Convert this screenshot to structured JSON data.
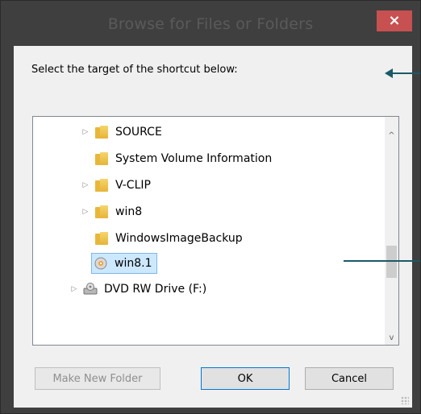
{
  "window": {
    "title": "Browse for Files or Folders",
    "close_glyph": "×"
  },
  "prompt": "Select the target of the shortcut below:",
  "tree": {
    "items": [
      {
        "label": "SOURCE",
        "expander": "▷",
        "icon": "folder-icon"
      },
      {
        "label": "System Volume Information",
        "expander": "",
        "icon": "folder-icon"
      },
      {
        "label": "V-CLIP",
        "expander": "▷",
        "icon": "folder-icon"
      },
      {
        "label": "win8",
        "expander": "▷",
        "icon": "folder-icon"
      },
      {
        "label": "WindowsImageBackup",
        "expander": "",
        "icon": "folder-icon"
      },
      {
        "label": "win8.1",
        "expander": "",
        "icon": "disc-image-icon",
        "selected": true
      },
      {
        "label": "DVD RW Drive (F:)",
        "expander": "▷",
        "icon": "dvd-drive-icon"
      }
    ],
    "scroll_up": "^",
    "scroll_down": "v"
  },
  "buttons": {
    "make_new_folder": "Make New Folder",
    "ok": "OK",
    "cancel": "Cancel"
  },
  "colors": {
    "arrow": "#1b5a66",
    "close": "#c75050",
    "selection": "#cce8ff"
  }
}
